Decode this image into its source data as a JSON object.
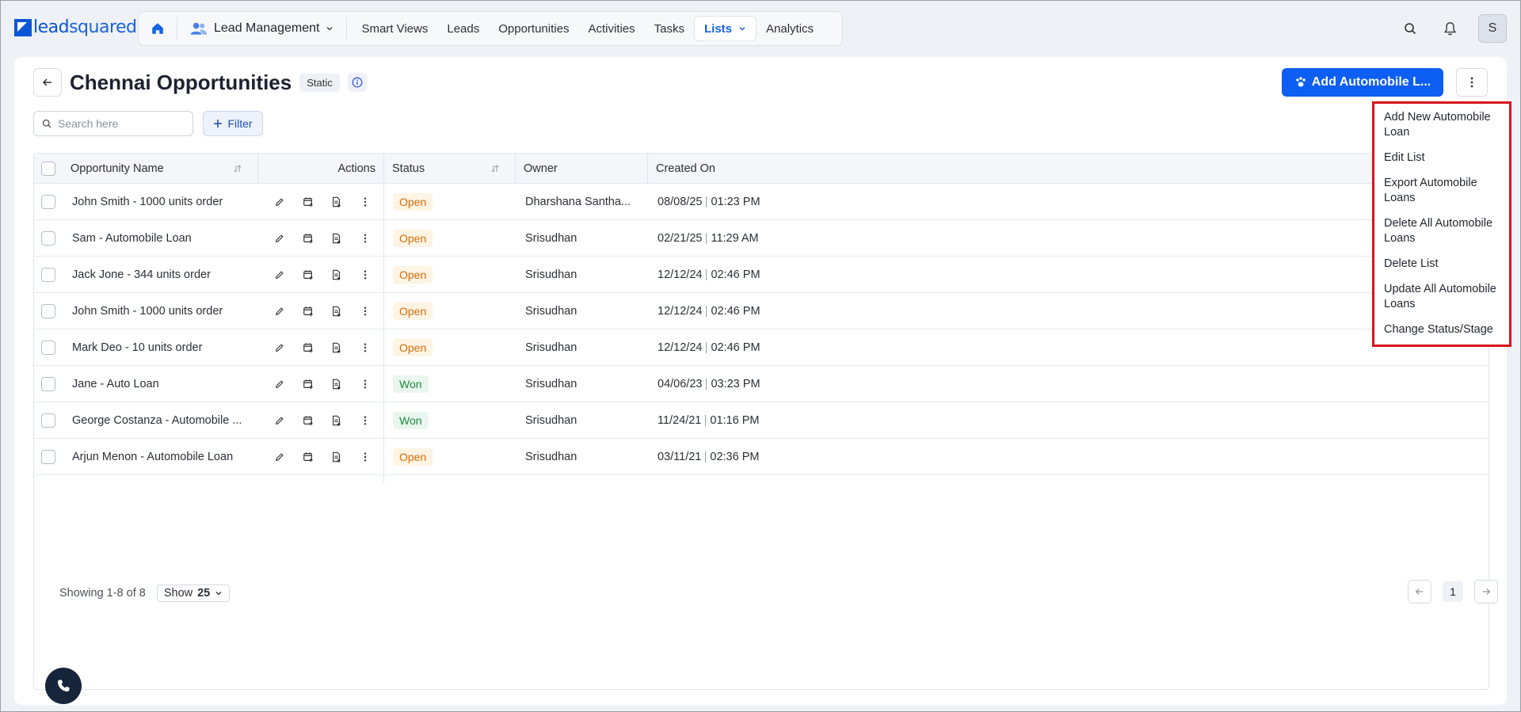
{
  "brand": {
    "logo_text_a": "lead",
    "logo_text_b": "squared"
  },
  "nav": {
    "module": "Lead Management",
    "items": [
      "Smart Views",
      "Leads",
      "Opportunities",
      "Activities",
      "Tasks",
      "Lists",
      "Analytics"
    ],
    "active": "Lists"
  },
  "user": {
    "avatar_initial": "S"
  },
  "page": {
    "title": "Chennai Opportunities",
    "badge": "Static",
    "primary_button": "Add Automobile L...",
    "search_placeholder": "Search here",
    "filter_label": "Filter"
  },
  "table": {
    "headers": {
      "name": "Opportunity Name",
      "actions": "Actions",
      "status": "Status",
      "owner": "Owner",
      "created": "Created On"
    },
    "rows": [
      {
        "name": "John Smith - 1000 units order",
        "status": "Open",
        "owner": "Dharshana Santha...",
        "date": "08/08/25",
        "time": "01:23 PM"
      },
      {
        "name": "Sam - Automobile Loan",
        "status": "Open",
        "owner": "Srisudhan",
        "date": "02/21/25",
        "time": "11:29 AM"
      },
      {
        "name": "Jack Jone - 344 units order",
        "status": "Open",
        "owner": "Srisudhan",
        "date": "12/12/24",
        "time": "02:46 PM"
      },
      {
        "name": "John Smith - 1000 units order",
        "status": "Open",
        "owner": "Srisudhan",
        "date": "12/12/24",
        "time": "02:46 PM"
      },
      {
        "name": "Mark Deo - 10 units order",
        "status": "Open",
        "owner": "Srisudhan",
        "date": "12/12/24",
        "time": "02:46 PM"
      },
      {
        "name": "Jane - Auto Loan",
        "status": "Won",
        "owner": "Srisudhan",
        "date": "04/06/23",
        "time": "03:23 PM"
      },
      {
        "name": "George Costanza - Automobile ...",
        "status": "Won",
        "owner": "Srisudhan",
        "date": "11/24/21",
        "time": "01:16 PM"
      },
      {
        "name": "Arjun Menon - Automobile Loan",
        "status": "Open",
        "owner": "Srisudhan",
        "date": "03/11/21",
        "time": "02:36 PM"
      }
    ]
  },
  "footer": {
    "showing": "Showing 1-8 of 8",
    "show_label": "Show",
    "show_value": "25",
    "page": "1"
  },
  "menu": {
    "items": [
      "Add New Automobile Loan",
      "Edit List",
      "Export Automobile Loans",
      "Delete All Automobile Loans",
      "Delete List",
      "Update All Automobile Loans",
      "Change Status/Stage"
    ]
  },
  "colors": {
    "accent": "#0d5ef2",
    "open": "#d36d0a",
    "won": "#1e8a3c",
    "menu_border": "#d8141c"
  }
}
